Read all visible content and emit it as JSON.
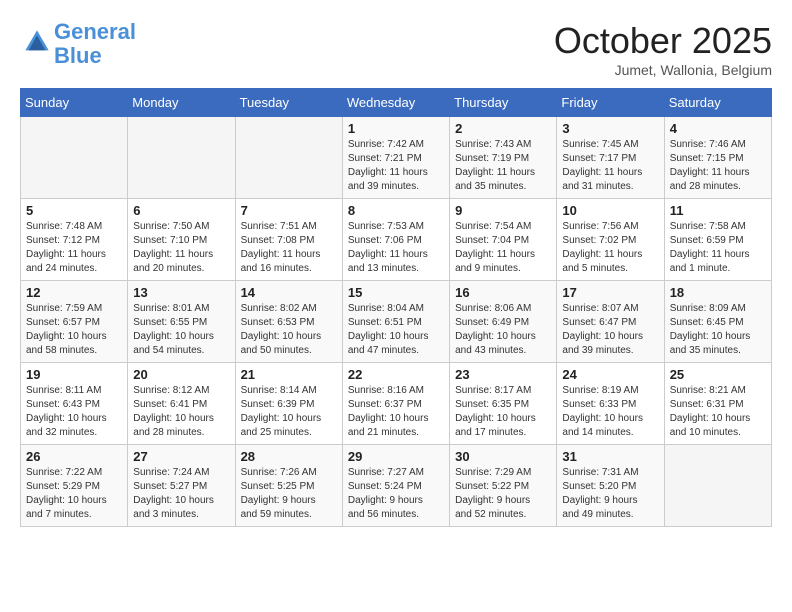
{
  "header": {
    "logo_line1": "General",
    "logo_line2": "Blue",
    "month_title": "October 2025",
    "location": "Jumet, Wallonia, Belgium"
  },
  "days_of_week": [
    "Sunday",
    "Monday",
    "Tuesday",
    "Wednesday",
    "Thursday",
    "Friday",
    "Saturday"
  ],
  "weeks": [
    [
      {
        "day": "",
        "info": ""
      },
      {
        "day": "",
        "info": ""
      },
      {
        "day": "",
        "info": ""
      },
      {
        "day": "1",
        "info": "Sunrise: 7:42 AM\nSunset: 7:21 PM\nDaylight: 11 hours\nand 39 minutes."
      },
      {
        "day": "2",
        "info": "Sunrise: 7:43 AM\nSunset: 7:19 PM\nDaylight: 11 hours\nand 35 minutes."
      },
      {
        "day": "3",
        "info": "Sunrise: 7:45 AM\nSunset: 7:17 PM\nDaylight: 11 hours\nand 31 minutes."
      },
      {
        "day": "4",
        "info": "Sunrise: 7:46 AM\nSunset: 7:15 PM\nDaylight: 11 hours\nand 28 minutes."
      }
    ],
    [
      {
        "day": "5",
        "info": "Sunrise: 7:48 AM\nSunset: 7:12 PM\nDaylight: 11 hours\nand 24 minutes."
      },
      {
        "day": "6",
        "info": "Sunrise: 7:50 AM\nSunset: 7:10 PM\nDaylight: 11 hours\nand 20 minutes."
      },
      {
        "day": "7",
        "info": "Sunrise: 7:51 AM\nSunset: 7:08 PM\nDaylight: 11 hours\nand 16 minutes."
      },
      {
        "day": "8",
        "info": "Sunrise: 7:53 AM\nSunset: 7:06 PM\nDaylight: 11 hours\nand 13 minutes."
      },
      {
        "day": "9",
        "info": "Sunrise: 7:54 AM\nSunset: 7:04 PM\nDaylight: 11 hours\nand 9 minutes."
      },
      {
        "day": "10",
        "info": "Sunrise: 7:56 AM\nSunset: 7:02 PM\nDaylight: 11 hours\nand 5 minutes."
      },
      {
        "day": "11",
        "info": "Sunrise: 7:58 AM\nSunset: 6:59 PM\nDaylight: 11 hours\nand 1 minute."
      }
    ],
    [
      {
        "day": "12",
        "info": "Sunrise: 7:59 AM\nSunset: 6:57 PM\nDaylight: 10 hours\nand 58 minutes."
      },
      {
        "day": "13",
        "info": "Sunrise: 8:01 AM\nSunset: 6:55 PM\nDaylight: 10 hours\nand 54 minutes."
      },
      {
        "day": "14",
        "info": "Sunrise: 8:02 AM\nSunset: 6:53 PM\nDaylight: 10 hours\nand 50 minutes."
      },
      {
        "day": "15",
        "info": "Sunrise: 8:04 AM\nSunset: 6:51 PM\nDaylight: 10 hours\nand 47 minutes."
      },
      {
        "day": "16",
        "info": "Sunrise: 8:06 AM\nSunset: 6:49 PM\nDaylight: 10 hours\nand 43 minutes."
      },
      {
        "day": "17",
        "info": "Sunrise: 8:07 AM\nSunset: 6:47 PM\nDaylight: 10 hours\nand 39 minutes."
      },
      {
        "day": "18",
        "info": "Sunrise: 8:09 AM\nSunset: 6:45 PM\nDaylight: 10 hours\nand 35 minutes."
      }
    ],
    [
      {
        "day": "19",
        "info": "Sunrise: 8:11 AM\nSunset: 6:43 PM\nDaylight: 10 hours\nand 32 minutes."
      },
      {
        "day": "20",
        "info": "Sunrise: 8:12 AM\nSunset: 6:41 PM\nDaylight: 10 hours\nand 28 minutes."
      },
      {
        "day": "21",
        "info": "Sunrise: 8:14 AM\nSunset: 6:39 PM\nDaylight: 10 hours\nand 25 minutes."
      },
      {
        "day": "22",
        "info": "Sunrise: 8:16 AM\nSunset: 6:37 PM\nDaylight: 10 hours\nand 21 minutes."
      },
      {
        "day": "23",
        "info": "Sunrise: 8:17 AM\nSunset: 6:35 PM\nDaylight: 10 hours\nand 17 minutes."
      },
      {
        "day": "24",
        "info": "Sunrise: 8:19 AM\nSunset: 6:33 PM\nDaylight: 10 hours\nand 14 minutes."
      },
      {
        "day": "25",
        "info": "Sunrise: 8:21 AM\nSunset: 6:31 PM\nDaylight: 10 hours\nand 10 minutes."
      }
    ],
    [
      {
        "day": "26",
        "info": "Sunrise: 7:22 AM\nSunset: 5:29 PM\nDaylight: 10 hours\nand 7 minutes."
      },
      {
        "day": "27",
        "info": "Sunrise: 7:24 AM\nSunset: 5:27 PM\nDaylight: 10 hours\nand 3 minutes."
      },
      {
        "day": "28",
        "info": "Sunrise: 7:26 AM\nSunset: 5:25 PM\nDaylight: 9 hours\nand 59 minutes."
      },
      {
        "day": "29",
        "info": "Sunrise: 7:27 AM\nSunset: 5:24 PM\nDaylight: 9 hours\nand 56 minutes."
      },
      {
        "day": "30",
        "info": "Sunrise: 7:29 AM\nSunset: 5:22 PM\nDaylight: 9 hours\nand 52 minutes."
      },
      {
        "day": "31",
        "info": "Sunrise: 7:31 AM\nSunset: 5:20 PM\nDaylight: 9 hours\nand 49 minutes."
      },
      {
        "day": "",
        "info": ""
      }
    ]
  ]
}
